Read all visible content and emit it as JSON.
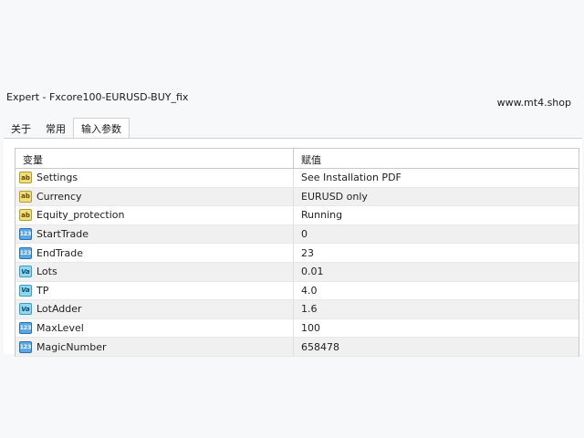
{
  "window": {
    "title": "Expert - Fxcore100-EURUSD-BUY_fix",
    "watermark": "www.mt4.shop"
  },
  "tabs": [
    {
      "label": "关于",
      "active": false
    },
    {
      "label": "常用",
      "active": false
    },
    {
      "label": "输入参数",
      "active": true
    }
  ],
  "grid": {
    "headers": {
      "variable": "变量",
      "value": "赋值"
    },
    "rows": [
      {
        "name": "Settings",
        "value": "See Installation PDF",
        "type": "ab"
      },
      {
        "name": "Currency",
        "value": "EURUSD only",
        "type": "ab"
      },
      {
        "name": "Equity_protection",
        "value": "Running",
        "type": "ab"
      },
      {
        "name": "StartTrade",
        "value": "0",
        "type": "123"
      },
      {
        "name": "EndTrade",
        "value": "23",
        "type": "123"
      },
      {
        "name": "Lots",
        "value": "0.01",
        "type": "Va"
      },
      {
        "name": "TP",
        "value": "4.0",
        "type": "Va"
      },
      {
        "name": "LotAdder",
        "value": "1.6",
        "type": "Va"
      },
      {
        "name": "MaxLevel",
        "value": "100",
        "type": "123"
      },
      {
        "name": "MagicNumber",
        "value": "658478",
        "type": "123"
      }
    ]
  }
}
